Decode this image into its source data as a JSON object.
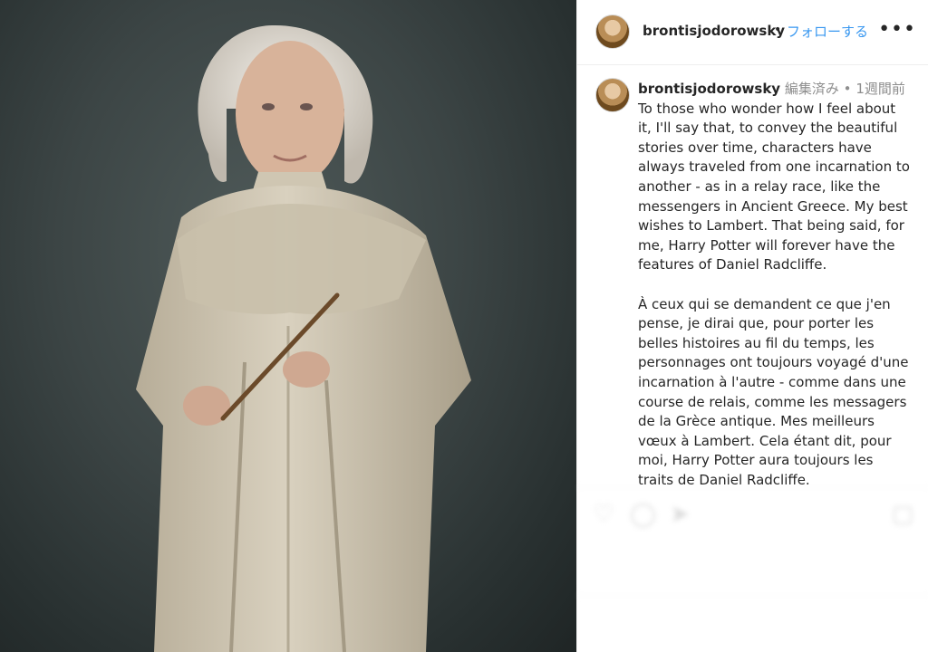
{
  "post": {
    "username": "brontisjodorowsky",
    "follow_label": "フォローする",
    "separator": "•",
    "more_label": "•••"
  },
  "caption": {
    "username": "brontisjodorowsky",
    "edited": "編集済み",
    "separator": "•",
    "time": "1週間前",
    "paragraph_en": "To those who wonder how I feel about it, I'll say that, to convey the beautiful stories over time, characters have always traveled from one incarnation to another - as in a relay race, like the messengers in Ancient Greece. My best wishes to Lambert. That being said, for me, Harry Potter will forever have the features of Daniel Radcliffe.",
    "paragraph_fr": "À ceux qui se demandent ce que j'en pense, je dirai que, pour porter les belles histoires au fil du temps, les personnages ont toujours voyagé d'une incarnation à l'autre - comme dans une course de relais, comme les messagers de la Grèce antique. Mes meilleurs vœux à Lambert. Cela étant dit, pour moi, Harry Potter aura toujours les traits de Daniel Radcliffe."
  },
  "actions": {
    "icons": [
      "heart-icon",
      "comment-icon",
      "share-icon",
      "bookmark-icon"
    ]
  },
  "colors": {
    "accent": "#3897f0",
    "text": "#262626",
    "muted": "#8e8e8e",
    "border": "#efefef"
  }
}
